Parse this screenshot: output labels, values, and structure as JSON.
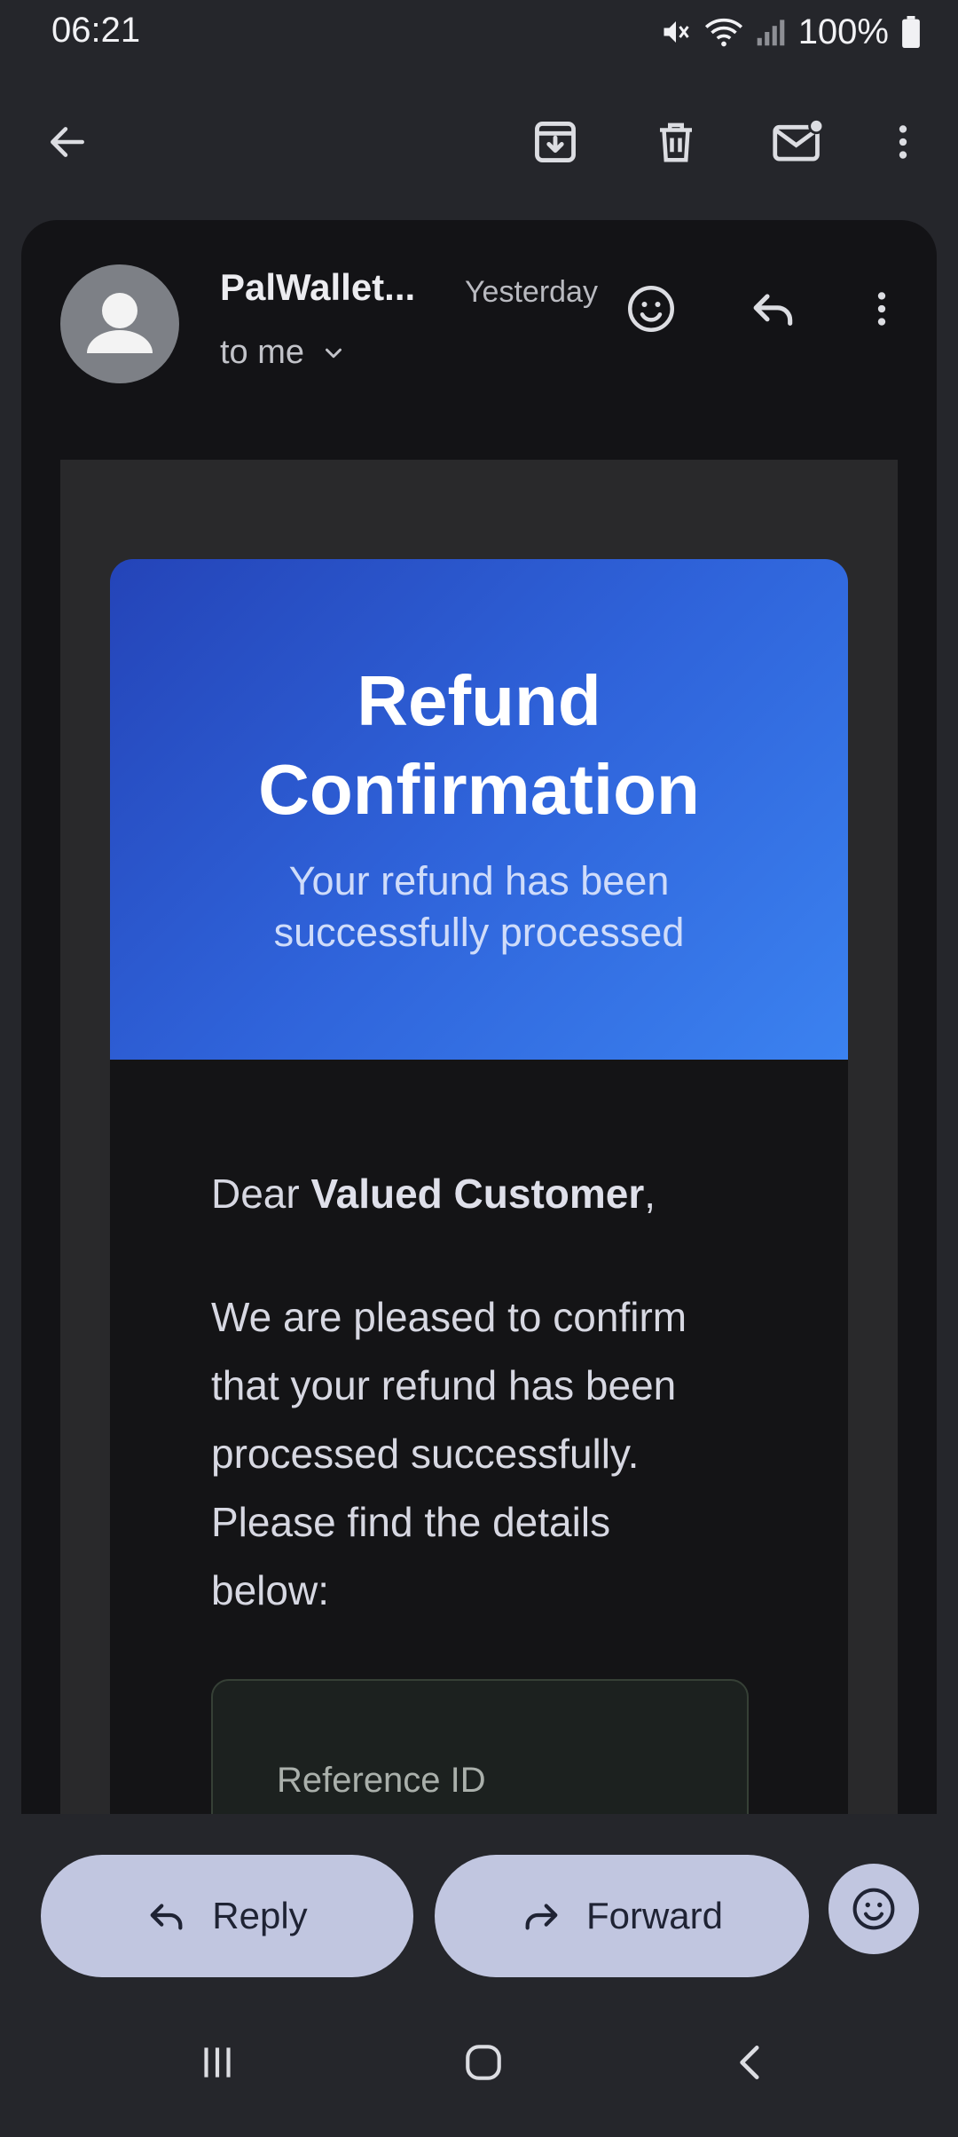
{
  "status_bar": {
    "time": "06:21",
    "battery": "100%",
    "icons": [
      "mute-icon",
      "wifi-icon",
      "signal-icon",
      "battery-icon"
    ]
  },
  "top_bar": {
    "icons": [
      "back-arrow-icon",
      "archive-icon",
      "delete-icon",
      "mark-unread-icon",
      "more-vert-icon"
    ]
  },
  "email": {
    "sender": "PalWallet...",
    "date": "Yesterday",
    "recipient": "to me"
  },
  "hero": {
    "title_line1": "Refund",
    "title_line2": "Confirmation",
    "subtitle_line1": "Your refund has been",
    "subtitle_line2": "successfully processed",
    "gradient_start": "#2444b8",
    "gradient_end": "#3b82f0"
  },
  "body": {
    "greeting_prefix": "Dear ",
    "greeting_name": "Valued Customer",
    "greeting_suffix": ",",
    "paragraph_lines": [
      "We are pleased to confirm",
      "that your refund has been",
      "processed successfully.",
      "Please find the details",
      "below:"
    ],
    "reference_label": "Reference ID"
  },
  "actions": {
    "reply": "Reply",
    "forward": "Forward"
  },
  "nav": {
    "icons": [
      "recent-apps-icon",
      "home-icon",
      "nav-back-icon"
    ]
  },
  "colors": {
    "background": "#25262b",
    "card": "#131316",
    "pill": "#c1c6e0"
  }
}
